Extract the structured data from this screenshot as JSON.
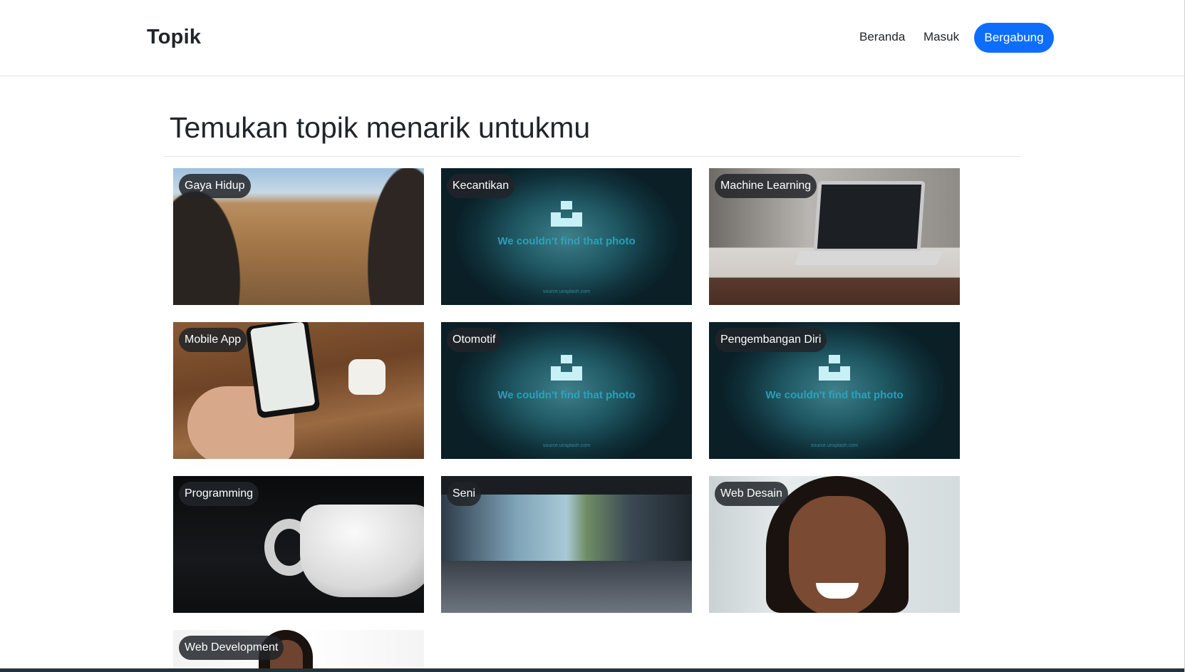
{
  "navbar": {
    "brand": "Topik",
    "links": {
      "home": "Beranda",
      "login": "Masuk"
    },
    "join_button": "Bergabung"
  },
  "page": {
    "title": "Temukan topik menarik untukmu"
  },
  "missing_image": {
    "message": "We couldn't find that photo",
    "source": "source.unsplash.com"
  },
  "topics": [
    {
      "label": "Gaya Hidup",
      "image": "lifestyle"
    },
    {
      "label": "Kecantikan",
      "image": "missing"
    },
    {
      "label": "Machine Learning",
      "image": "laptop"
    },
    {
      "label": "Mobile App",
      "image": "phone-airpods"
    },
    {
      "label": "Otomotif",
      "image": "missing"
    },
    {
      "label": "Pengembangan Diri",
      "image": "missing"
    },
    {
      "label": "Programming",
      "image": "coffee-cup"
    },
    {
      "label": "Seni",
      "image": "walkway"
    },
    {
      "label": "Web Desain",
      "image": "portrait"
    },
    {
      "label": "Web Development",
      "image": "portrait"
    }
  ],
  "colors": {
    "primary": "#0d6efd",
    "label_bg": "#212529",
    "text": "#212529",
    "divider": "#dee2e6"
  }
}
